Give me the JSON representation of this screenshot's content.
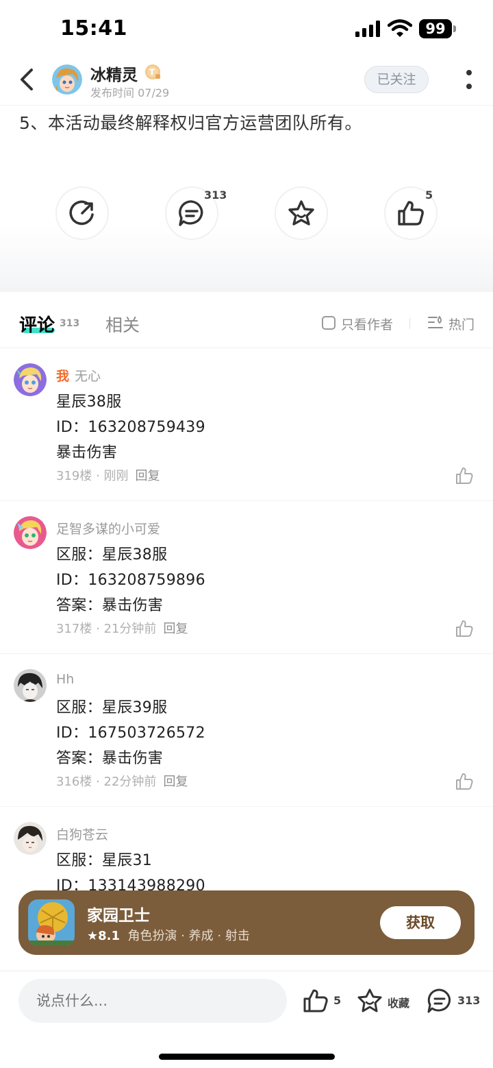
{
  "status_bar": {
    "time": "15:41",
    "battery": "99"
  },
  "header": {
    "author_name": "冰精灵",
    "publish_time": "发布时间 07/29",
    "follow_label": "已关注"
  },
  "article": {
    "last_line": "5、本活动最终解释权归官方运营团队所有。"
  },
  "actions": {
    "comment_count": "313",
    "like_count": "5"
  },
  "tabs": {
    "comments_label": "评论",
    "comments_count": "313",
    "related_label": "相关",
    "author_only_label": "只看作者",
    "sort_label": "热门"
  },
  "comments": [
    {
      "me_tag": "我",
      "user": "无心",
      "lines": [
        "星辰38服",
        "ID：163208759439",
        "暴击伤害"
      ],
      "floor": "319楼",
      "time": "刚刚",
      "reply": "回复"
    },
    {
      "user": "足智多谋的小可爱",
      "lines": [
        "区服：星辰38服",
        "ID：163208759896",
        "答案：暴击伤害"
      ],
      "floor": "317楼",
      "time": "21分钟前",
      "reply": "回复"
    },
    {
      "user": "Hh",
      "lines": [
        "区服：星辰39服",
        "ID：167503726572",
        "答案：暴击伤害"
      ],
      "floor": "316楼",
      "time": "22分钟前",
      "reply": "回复"
    },
    {
      "user": "白狗苍云",
      "lines": [
        "区服：星辰31",
        "ID：133143988290"
      ]
    }
  ],
  "game_banner": {
    "title": "家园卫士",
    "rating": "8.1",
    "tags": "角色扮演 · 养成 · 射击",
    "get_label": "获取"
  },
  "bottom_bar": {
    "input_placeholder": "说点什么...",
    "like_count": "5",
    "favorite_label": "收藏",
    "comment_count": "313"
  }
}
